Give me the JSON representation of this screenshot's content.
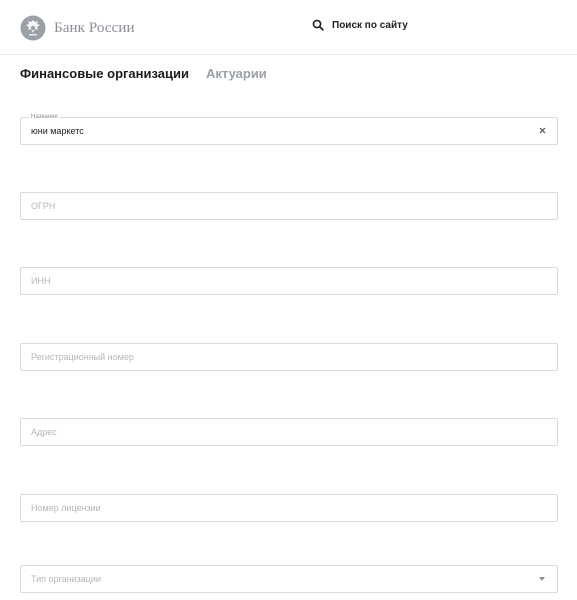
{
  "header": {
    "logo_text": "Банк России",
    "logo_icon": "double-headed-eagle-emblem",
    "search_label": "Поиск по сайту",
    "search_icon": "search-icon"
  },
  "tabs": [
    {
      "label": "Финансовые организации",
      "active": true
    },
    {
      "label": "Актуарии",
      "active": false
    }
  ],
  "form": {
    "name": {
      "legend": "Название",
      "value": "юни маркетс"
    },
    "ogrn": {
      "placeholder": "ОГРН"
    },
    "inn": {
      "placeholder": "ИНН"
    },
    "reg_number": {
      "placeholder": "Регистрационный номер"
    },
    "address": {
      "placeholder": "Адрес"
    },
    "license": {
      "placeholder": "Номер лицензии"
    },
    "org_type": {
      "placeholder": "Тип организации"
    }
  },
  "colors": {
    "text_dark": "#1f1f1f",
    "text_muted": "#9aa0a6",
    "border": "#d7d9dc"
  }
}
